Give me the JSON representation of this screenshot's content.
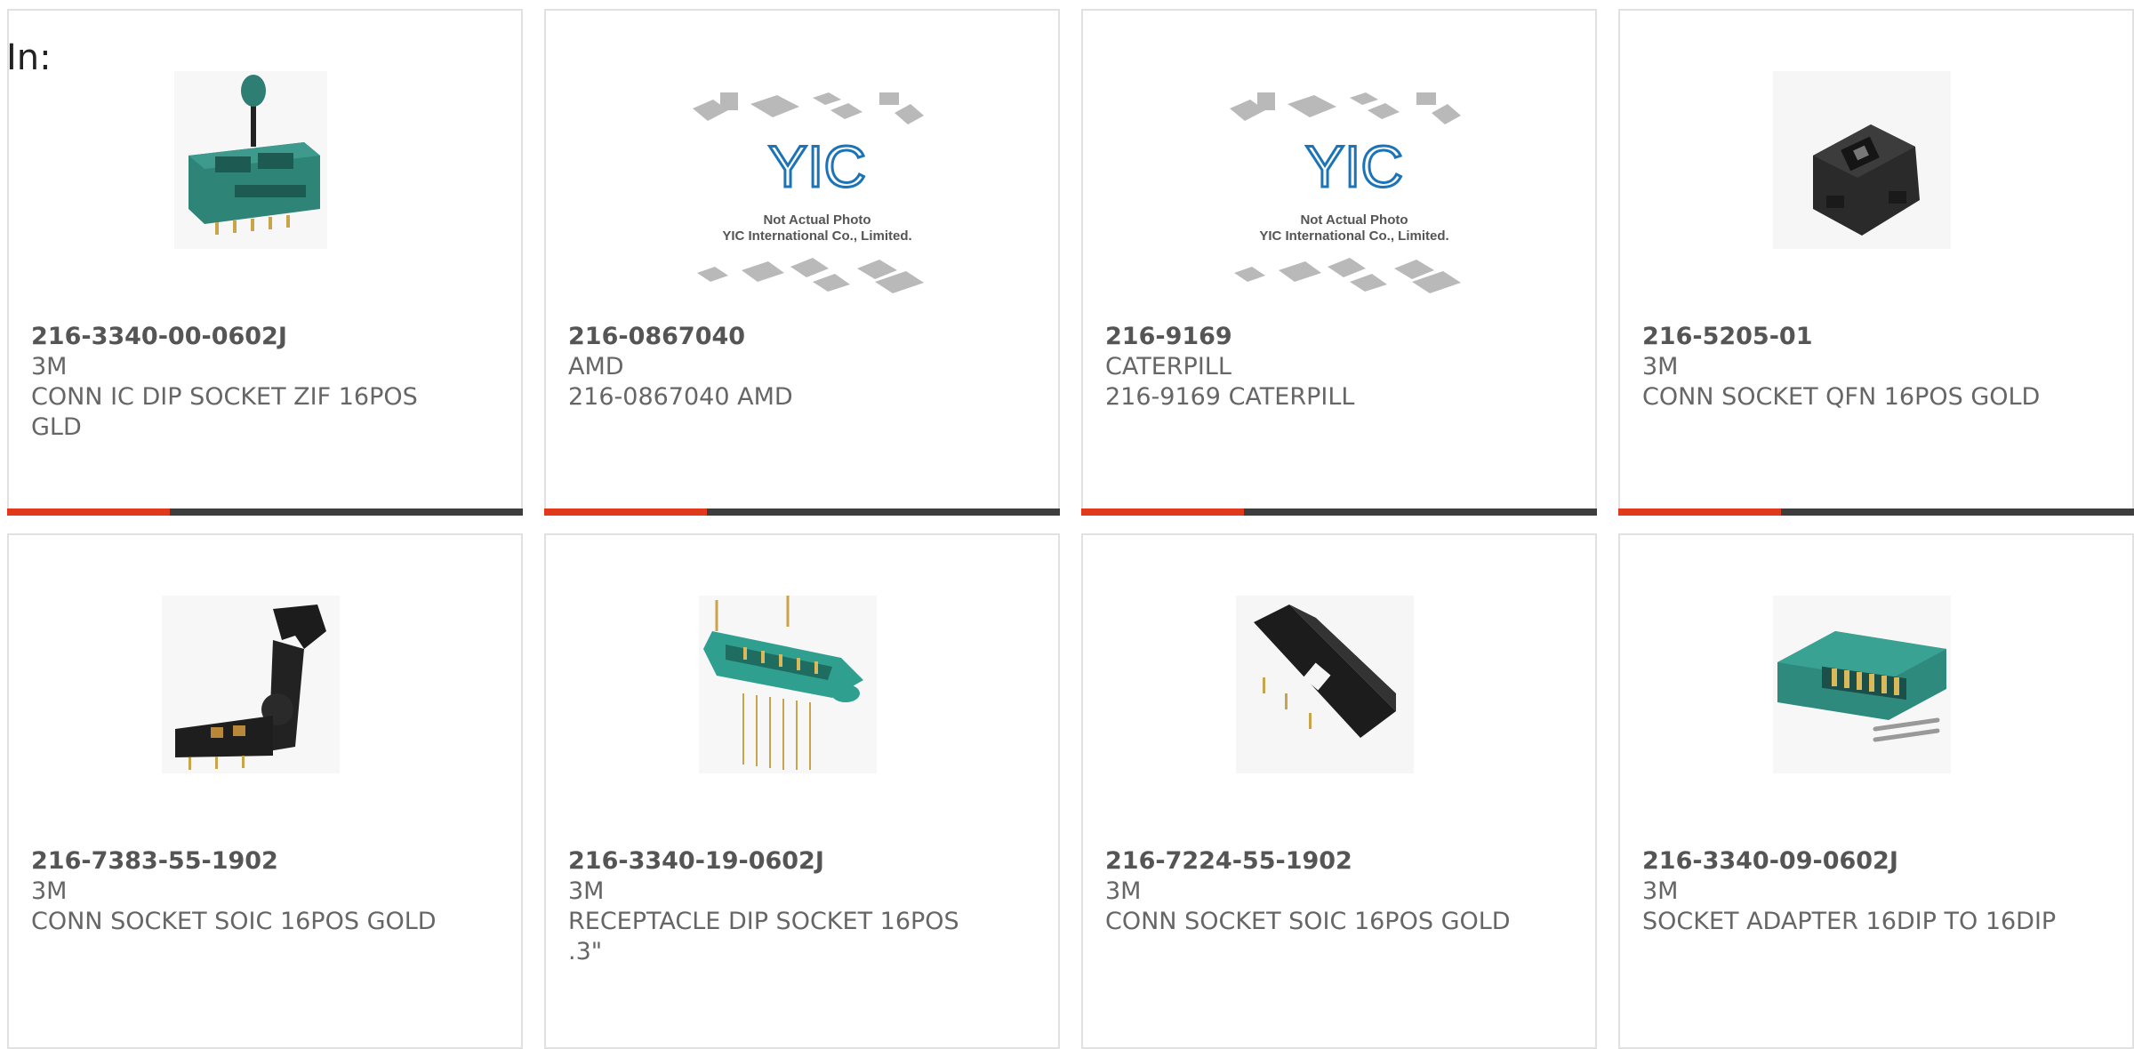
{
  "filter_label": "In:",
  "products": [
    {
      "part_number": "216-3340-00-0602J",
      "manufacturer": "3M",
      "description": "CONN IC DIP SOCKET ZIF 16POS GLD",
      "image": "zif-dip-socket-photo"
    },
    {
      "part_number": "216-0867040",
      "manufacturer": "AMD",
      "description": "216-0867040 AMD",
      "image": "placeholder-photo",
      "placeholder": {
        "logo": "YIC",
        "line1": "Not Actual Photo",
        "line2": "YIC International Co., Limited."
      }
    },
    {
      "part_number": "216-9169",
      "manufacturer": "CATERPILL",
      "description": "216-9169 CATERPILL",
      "image": "placeholder-photo",
      "placeholder": {
        "logo": "YIC",
        "line1": "Not Actual Photo",
        "line2": "YIC International Co., Limited."
      }
    },
    {
      "part_number": "216-5205-01",
      "manufacturer": "3M",
      "description": "CONN SOCKET QFN 16POS GOLD",
      "image": "qfn-socket-photo"
    },
    {
      "part_number": "216-7383-55-1902",
      "manufacturer": "3M",
      "description": "CONN SOCKET SOIC 16POS GOLD",
      "image": "soic-socket-open-photo"
    },
    {
      "part_number": "216-3340-19-0602J",
      "manufacturer": "3M",
      "description": "RECEPTACLE DIP SOCKET 16POS .3\"",
      "image": "dip-receptacle-photo"
    },
    {
      "part_number": "216-7224-55-1902",
      "manufacturer": "3M",
      "description": "CONN SOCKET SOIC 16POS GOLD",
      "image": "soic-socket-black-photo"
    },
    {
      "part_number": "216-3340-09-0602J",
      "manufacturer": "3M",
      "description": "SOCKET ADAPTER 16DIP TO 16DIP",
      "image": "socket-adapter-photo"
    }
  ],
  "colors": {
    "accent": "#e0391c",
    "bar": "#3d3d3d",
    "card_border": "#e1e1e1",
    "text": "#666666"
  }
}
